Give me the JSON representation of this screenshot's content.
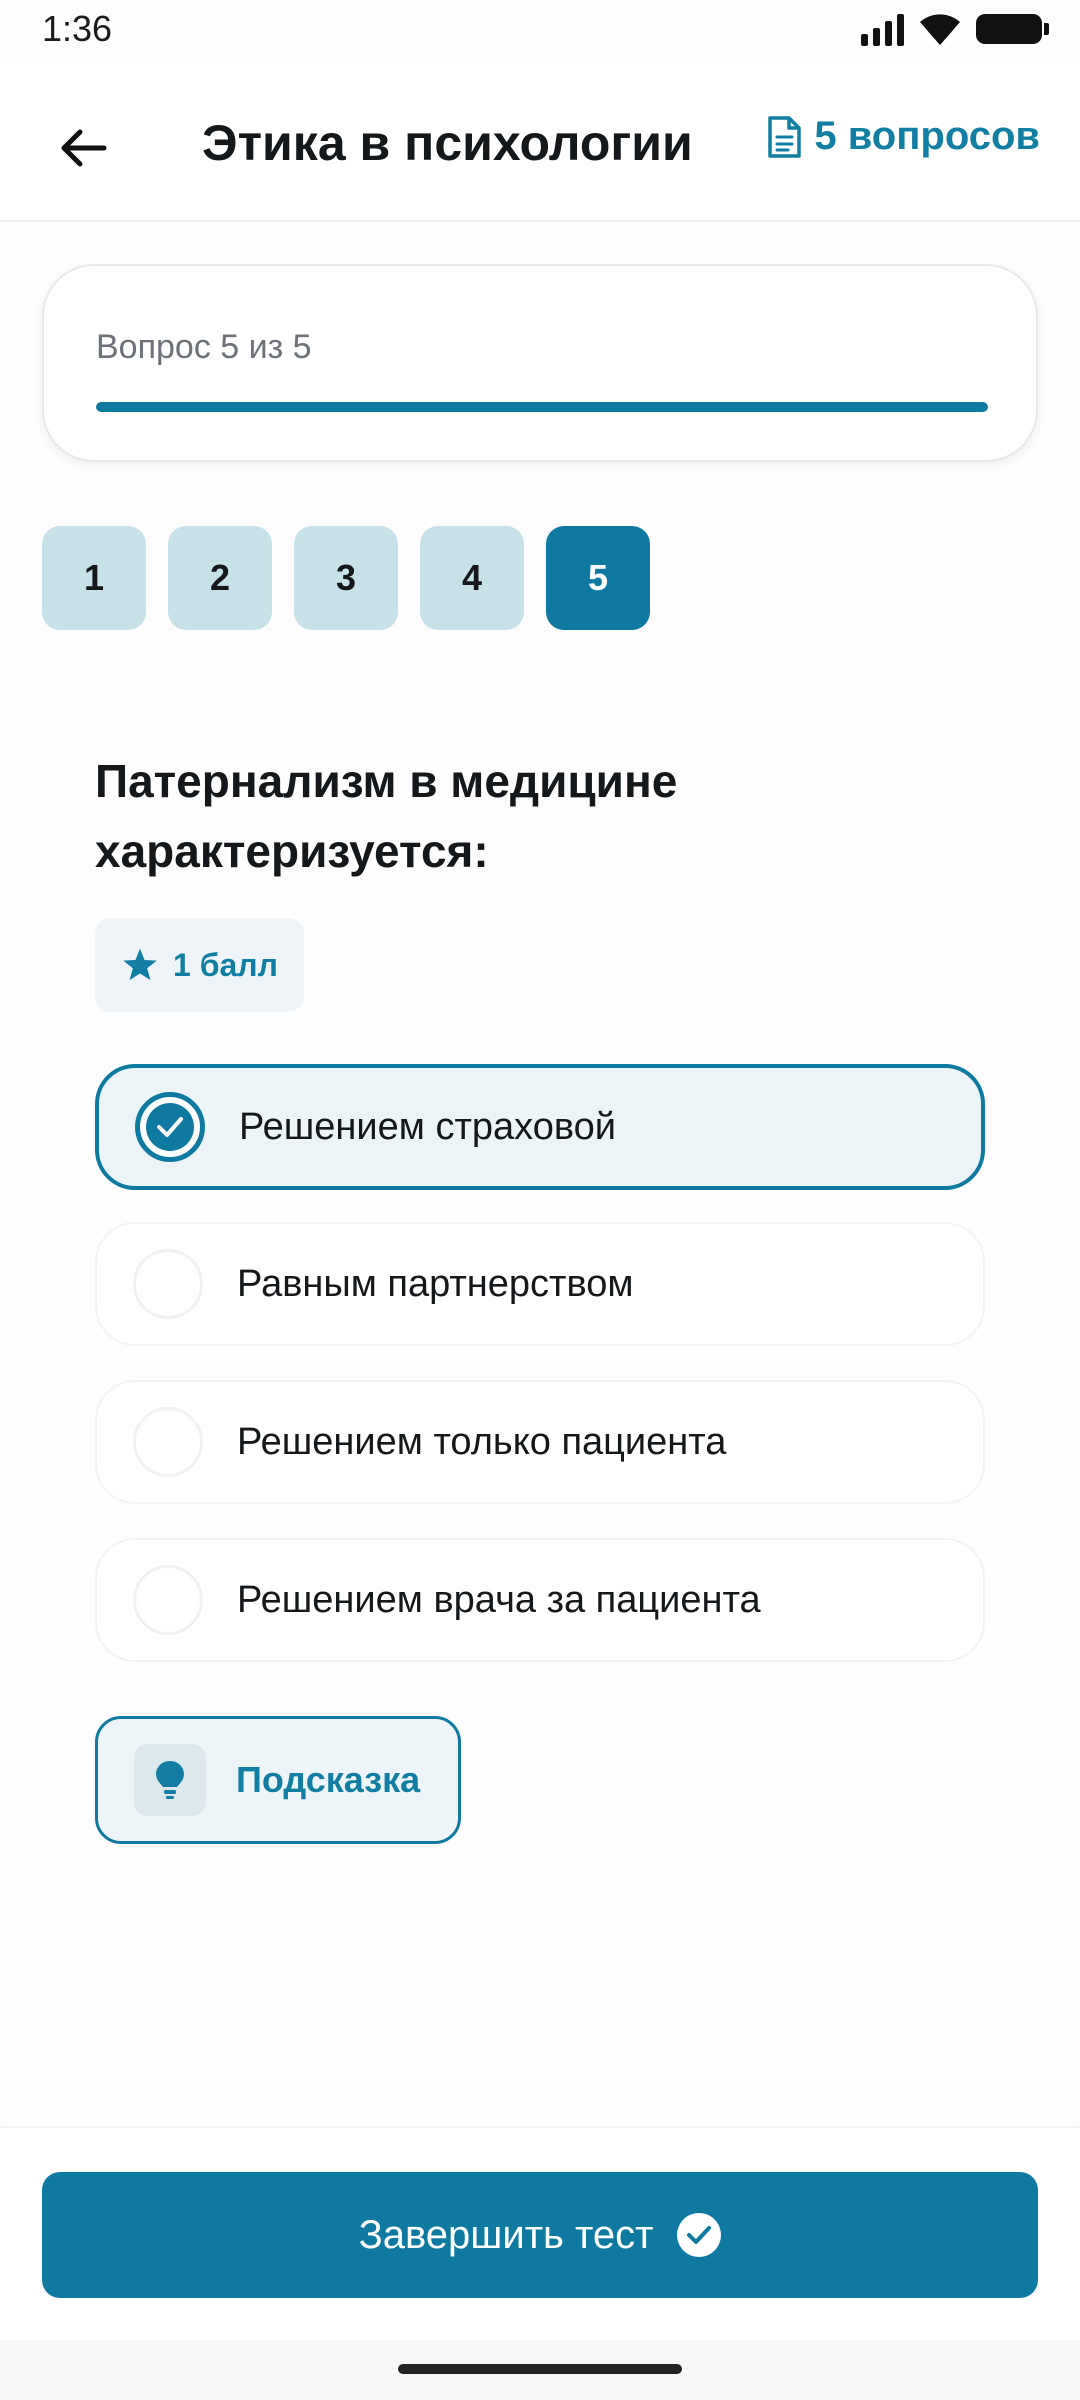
{
  "status_bar": {
    "time": "1:36",
    "icons": [
      "signal-icon",
      "wifi-icon",
      "battery-icon"
    ]
  },
  "header": {
    "back_icon": "arrow-left-icon",
    "title": "Этика в психологии",
    "questions_icon": "document-icon",
    "questions_count": "5 вопросов"
  },
  "progress": {
    "label": "Вопрос 5 из 5",
    "fraction": 1.0
  },
  "question_nav": {
    "items": [
      {
        "label": "1",
        "active": false
      },
      {
        "label": "2",
        "active": false
      },
      {
        "label": "3",
        "active": false
      },
      {
        "label": "4",
        "active": false
      },
      {
        "label": "5",
        "active": true
      }
    ]
  },
  "question": {
    "text": "Патернализм в медицине характеризуется:",
    "points_icon": "star-icon",
    "points": "1 балл"
  },
  "answers": [
    {
      "label": "Решением страховой",
      "selected": true
    },
    {
      "label": "Равным партнерством",
      "selected": false
    },
    {
      "label": "Решением только пациента",
      "selected": false
    },
    {
      "label": "Решением врача за пациента",
      "selected": false
    }
  ],
  "hint": {
    "icon": "lightbulb-icon",
    "label": "Подсказка"
  },
  "footer": {
    "finish_label": "Завершить тест",
    "finish_icon": "check-circle-icon"
  },
  "colors": {
    "accent": "#0f7aa1",
    "accent_text": "#127ea3",
    "nav_inactive": "#c7e1e9",
    "selected_bg": "#ecf4f7"
  }
}
